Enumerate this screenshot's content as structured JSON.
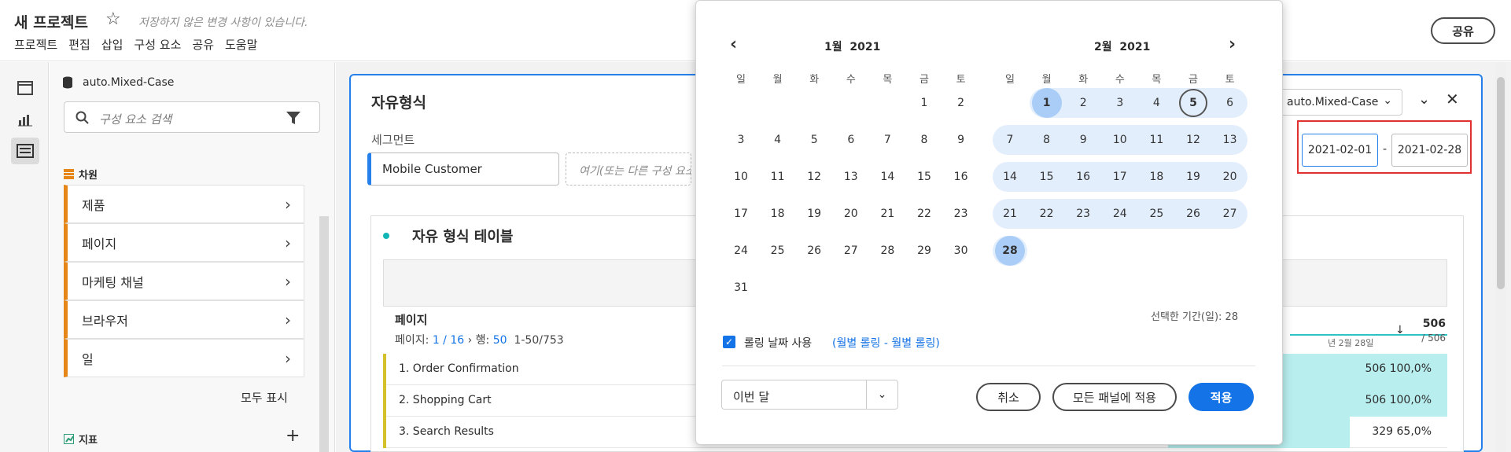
{
  "app": {
    "project_title": "새 프로젝트",
    "unsaved_notice": "저장하지 않은 변경 사항이 있습니다.",
    "menu": [
      "프로젝트",
      "편집",
      "삽입",
      "구성 요소",
      "공유",
      "도움말"
    ],
    "share_label": "공유"
  },
  "components_panel": {
    "data_source": "auto.Mixed-Case",
    "search_placeholder": "구성 요소 검색",
    "dimensions_header": "차원",
    "dimensions": [
      "제품",
      "페이지",
      "마케팅 채널",
      "브라우저",
      "일"
    ],
    "show_all": "모두 표시",
    "metrics_header": "지표"
  },
  "freeform_panel": {
    "title": "자유형식",
    "segment_label": "세그먼트",
    "segment_chip": "Mobile Customer",
    "segment_drop_hint": "여기(또는 다른 구성 요소를 드롭)",
    "data_source": "auto.Mixed-Case",
    "date_start": "2021-02-01",
    "date_sep": "-",
    "date_end": "2021-02-28"
  },
  "table": {
    "title": "자유 형식 테이블",
    "dimension_name": "페이지",
    "pager": {
      "page_label": "페이지:",
      "page": "1 / 16",
      "rows_label": "행:",
      "rows": "50",
      "range": "1-50/753"
    },
    "metric_total": "506",
    "metric_total_sub": "/ 506",
    "date_label": "년 2월 28일",
    "rows": [
      {
        "label": "1. Order Confirmation",
        "value": "506 100,0%",
        "pct": 1.0
      },
      {
        "label": "2. Shopping Cart",
        "value": "506 100,0%",
        "pct": 1.0
      },
      {
        "label": "3. Search Results",
        "value": "329 65,0%",
        "pct": 0.65
      }
    ]
  },
  "date_picker": {
    "left_month": "1월",
    "left_year": "2021",
    "right_month": "2월",
    "right_year": "2021",
    "weekdays": [
      "일",
      "월",
      "화",
      "수",
      "목",
      "금",
      "토"
    ],
    "selected_days_label": "선택한 기간(일): 28",
    "rolling_label": "롤링 날짜 사용",
    "rolling_detail": "(월별 롤링 - 월별 롤링)",
    "preset_value": "이번 달",
    "cancel": "취소",
    "apply_all": "모든 패널에 적용",
    "apply": "적용"
  },
  "colors": {
    "accent": "#1473e6",
    "dimension_bar": "#e68619",
    "highlight": "#e03030",
    "range": "#e3eefc"
  }
}
